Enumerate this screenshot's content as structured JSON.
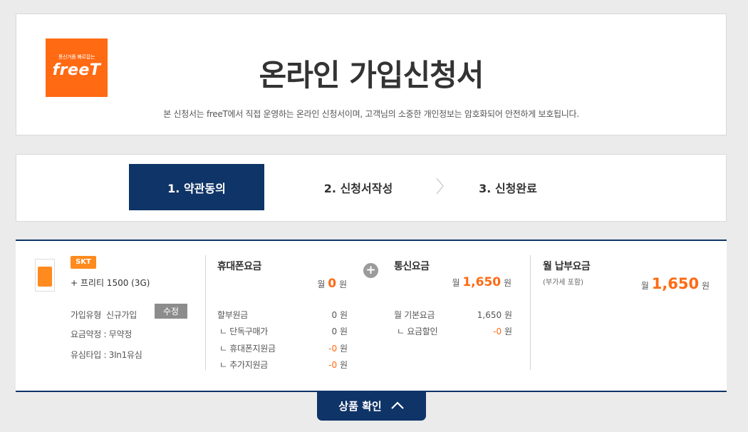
{
  "header": {
    "logo_tagline": "통신거품 빠르잡는",
    "logo_name": "freeT",
    "title": "온라인 가입신청서",
    "subtitle": "본 신청서는 freeT에서 직접 운영하는 온라인 신청서이며, 고객님의 소중한 개인정보는 암호화되어 안전하게 보호됩니다."
  },
  "steps": [
    {
      "label": "1. 약관동의",
      "active": true
    },
    {
      "label": "2. 신청서작성",
      "active": false
    },
    {
      "label": "3. 신청완료",
      "active": false
    }
  ],
  "product": {
    "sim_icon": "sim-card-icon",
    "carrier": "SKT",
    "plan": "+ 프리티 1500 (3G)",
    "join_type_label": "가입유형",
    "join_type_value": "신규가입",
    "edit_label": "수정",
    "contract_label": "요금약정 :",
    "contract_value": "무약정",
    "usim_label": "유심타입 :",
    "usim_value": "3In1유심"
  },
  "phone_fee": {
    "title": "휴대폰요금",
    "amount_prefix": "월",
    "amount": "0",
    "amount_unit": "원",
    "rows": [
      {
        "label": "할부원금",
        "value": "0",
        "unit": "원"
      },
      {
        "label": "ㄴ 단독구매가",
        "value": "0",
        "unit": "원"
      },
      {
        "label": "ㄴ 휴대폰지원금",
        "value": "-0",
        "unit": "원"
      },
      {
        "label": "ㄴ 추가지원금",
        "value": "-0",
        "unit": "원"
      }
    ]
  },
  "plus_icon": "+",
  "telecom_fee": {
    "title": "통신요금",
    "amount_prefix": "월",
    "amount": "1,650",
    "amount_unit": "원",
    "rows": [
      {
        "label": "월 기본요금",
        "value": "1,650",
        "unit": "원"
      },
      {
        "label": "ㄴ 요금할인",
        "value": "-0",
        "unit": "원"
      }
    ]
  },
  "monthly": {
    "title": "월 납부요금",
    "note": "(부가세 포함)",
    "amount_prefix": "월",
    "amount": "1,650",
    "amount_unit": "원"
  },
  "confirm_label": "상품 확인",
  "colors": {
    "navy": "#0f3467",
    "orange": "#ff6a13",
    "badge": "#ff8a1e"
  }
}
